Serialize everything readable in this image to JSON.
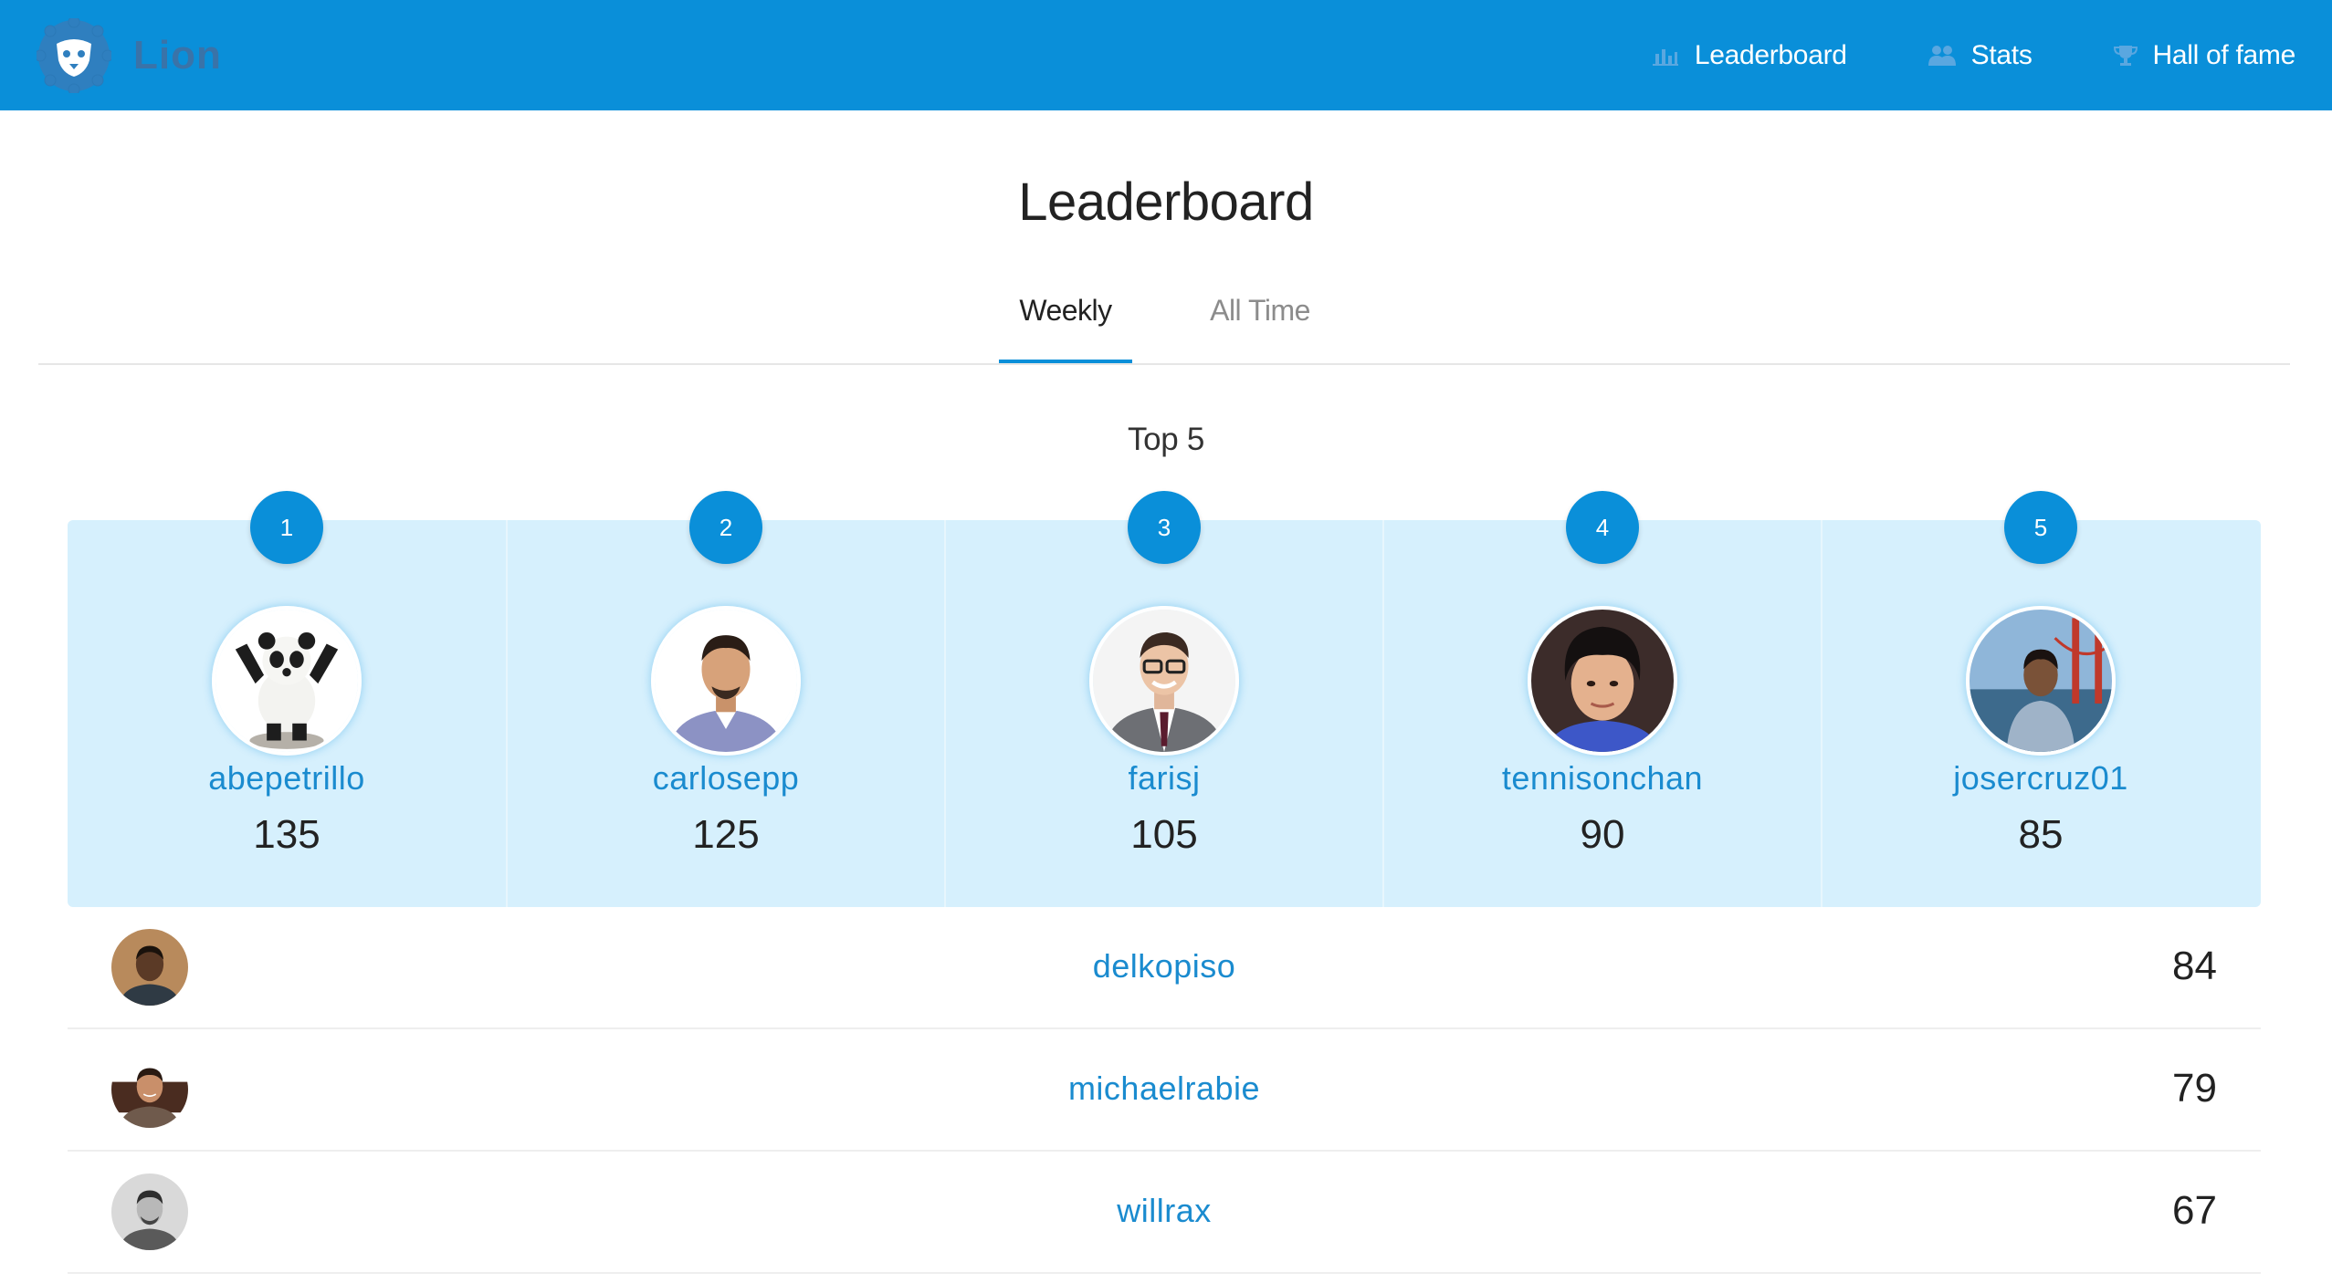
{
  "app": {
    "brand_name": "Lion",
    "accent_color": "#0a8fd9"
  },
  "nav": {
    "items": [
      {
        "label": "Leaderboard",
        "icon": "bar-chart-icon"
      },
      {
        "label": "Stats",
        "icon": "users-icon"
      },
      {
        "label": "Hall of fame",
        "icon": "trophy-icon"
      }
    ]
  },
  "page": {
    "title": "Leaderboard",
    "tabs": [
      {
        "label": "Weekly",
        "active": true
      },
      {
        "label": "All Time",
        "active": false
      }
    ],
    "top_section_title": "Top 5"
  },
  "top5": [
    {
      "rank": "1",
      "username": "abepetrillo",
      "score": "135",
      "avatar": "panda-avatar"
    },
    {
      "rank": "2",
      "username": "carlosepp",
      "score": "125",
      "avatar": "user-avatar"
    },
    {
      "rank": "3",
      "username": "farisj",
      "score": "105",
      "avatar": "user-avatar"
    },
    {
      "rank": "4",
      "username": "tennisonchan",
      "score": "90",
      "avatar": "user-avatar"
    },
    {
      "rank": "5",
      "username": "josercruz01",
      "score": "85",
      "avatar": "user-avatar"
    }
  ],
  "rest": [
    {
      "username": "delkopiso",
      "score": "84",
      "avatar": "user-avatar"
    },
    {
      "username": "michaelrabie",
      "score": "79",
      "avatar": "user-avatar"
    },
    {
      "username": "willrax",
      "score": "67",
      "avatar": "user-avatar"
    }
  ]
}
